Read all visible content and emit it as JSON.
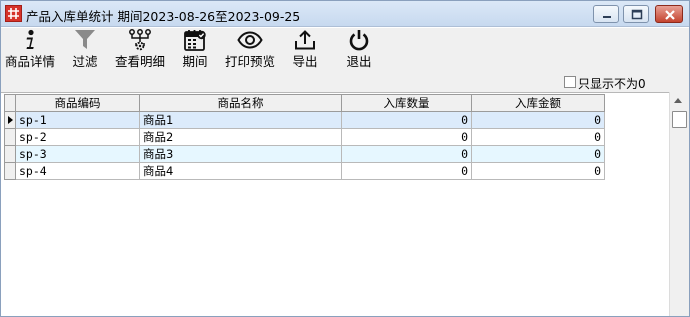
{
  "window": {
    "title": "产品入库单统计 期间2023-08-26至2023-09-25",
    "controls": {
      "minimize": "minimize-icon",
      "maximize": "maximize-icon",
      "close": "close-icon"
    }
  },
  "toolbar": {
    "items": [
      {
        "label": "商品详情",
        "icon": "info-icon"
      },
      {
        "label": "过滤",
        "icon": "filter-icon"
      },
      {
        "label": "查看明细",
        "icon": "detail-tree-icon"
      },
      {
        "label": "期间",
        "icon": "calendar-icon"
      },
      {
        "label": "打印预览",
        "icon": "eye-icon"
      },
      {
        "label": "导出",
        "icon": "export-icon"
      },
      {
        "label": "退出",
        "icon": "power-icon"
      }
    ]
  },
  "options": {
    "show_nonzero_only": {
      "label": "只显示不为0",
      "checked": false
    }
  },
  "grid": {
    "columns": [
      "商品编码",
      "商品名称",
      "入库数量",
      "入库金额"
    ],
    "rows": [
      {
        "code": "sp-1",
        "name": "商品1",
        "qty": "0",
        "amount": "0"
      },
      {
        "code": "sp-2",
        "name": "商品2",
        "qty": "0",
        "amount": "0"
      },
      {
        "code": "sp-3",
        "name": "商品3",
        "qty": "0",
        "amount": "0"
      },
      {
        "code": "sp-4",
        "name": "商品4",
        "qty": "0",
        "amount": "0"
      }
    ],
    "selected_row": 0
  },
  "colors": {
    "title_bar": "#c7d9ef",
    "alt_row": "#e6f7ff",
    "selected_row": "#dcebfb",
    "app_icon": "#d6332a"
  }
}
